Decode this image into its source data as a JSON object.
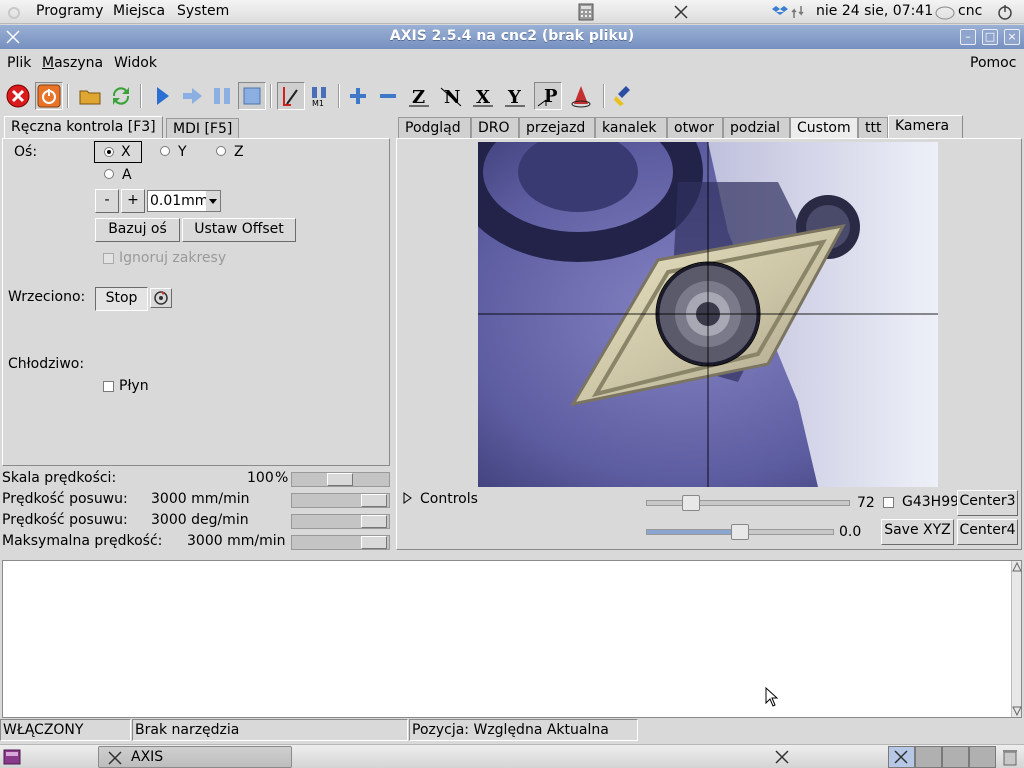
{
  "top_panel": {
    "menus": [
      "Programy",
      "Miejsca",
      "System"
    ],
    "clock": "nie 24 sie, 07:41",
    "user": "cnc"
  },
  "window": {
    "title": "AXIS 2.5.4 na cnc2 (brak pliku)"
  },
  "menubar": {
    "items": [
      "Plik",
      "Maszyna",
      "Widok"
    ],
    "help": "Pomoc"
  },
  "left_tabs": [
    "Ręczna kontrola [F3]",
    "MDI [F5]"
  ],
  "manual": {
    "axis_label": "Oś:",
    "axes": [
      "X",
      "Y",
      "Z",
      "A"
    ],
    "selected_axis": "X",
    "minus": "-",
    "plus": "+",
    "increment": "0.01mm",
    "home_axis": "Bazuj oś",
    "set_offset": "Ustaw Offset",
    "ignore_limits": "Ignoruj zakresy",
    "spindle_label": "Wrzeciono:",
    "stop": "Stop",
    "coolant_label": "Chłodziwo:",
    "flood": "Płyn"
  },
  "overrides": [
    {
      "label": "Skala prędkości:",
      "value": "100",
      "unit": "%",
      "level": 0.5
    },
    {
      "label": "Prędkość posuwu:",
      "value": "3000 mm/min",
      "unit": "",
      "level": 1.0
    },
    {
      "label": "Prędkość posuwu:",
      "value": "3000 deg/min",
      "unit": "",
      "level": 1.0
    },
    {
      "label": "Maksymalna prędkość:",
      "value": "3000 mm/min",
      "unit": "",
      "level": 1.0
    }
  ],
  "right_tabs": [
    "Podgląd",
    "DRO",
    "przejazd",
    "kanalek",
    "otwor",
    "podzial",
    "Custom",
    "ttt",
    "Kamera"
  ],
  "camera_panel": {
    "controls": "Controls",
    "slider1_value": "72",
    "slider1_level": 0.19,
    "slider2_value": "0.0",
    "slider2_level": 0.5,
    "g43": "G43H99",
    "center3": "Center3",
    "center4": "Center4",
    "save_xyz": "Save XYZ"
  },
  "statusbar": {
    "state": "WŁĄCZONY",
    "tool": "Brak narzędzia",
    "position": "Pozycja: Względna Aktualna"
  },
  "taskbar": {
    "app": "AXIS"
  }
}
